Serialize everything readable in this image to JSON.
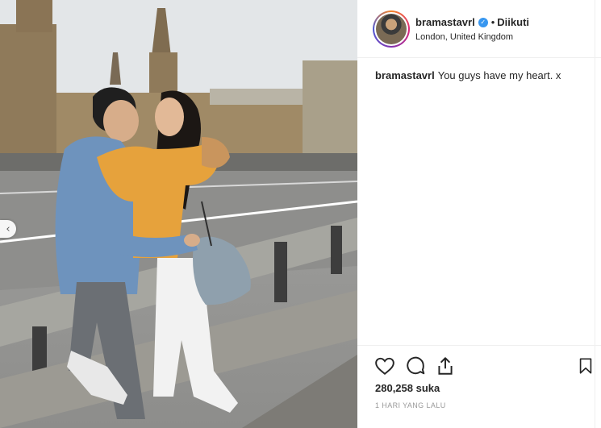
{
  "post": {
    "username": "bramastavrl",
    "follow_status": "Diikuti",
    "separator": "•",
    "location": "London, United Kingdom",
    "caption_user": "bramastavrl",
    "caption_text": "You guys have my heart. x",
    "likes": "280,258 suka",
    "time": "1 HARI YANG LALU"
  },
  "photo": {
    "carousel_prev_glyph": "‹"
  },
  "icons": {
    "verified": "verified-badge-icon",
    "like": "heart-icon",
    "comment": "comment-icon",
    "share": "share-icon",
    "save": "bookmark-icon",
    "prev": "chevron-left-icon"
  },
  "colors": {
    "verified_blue": "#3897f0",
    "text": "#262626",
    "muted": "#999999"
  }
}
